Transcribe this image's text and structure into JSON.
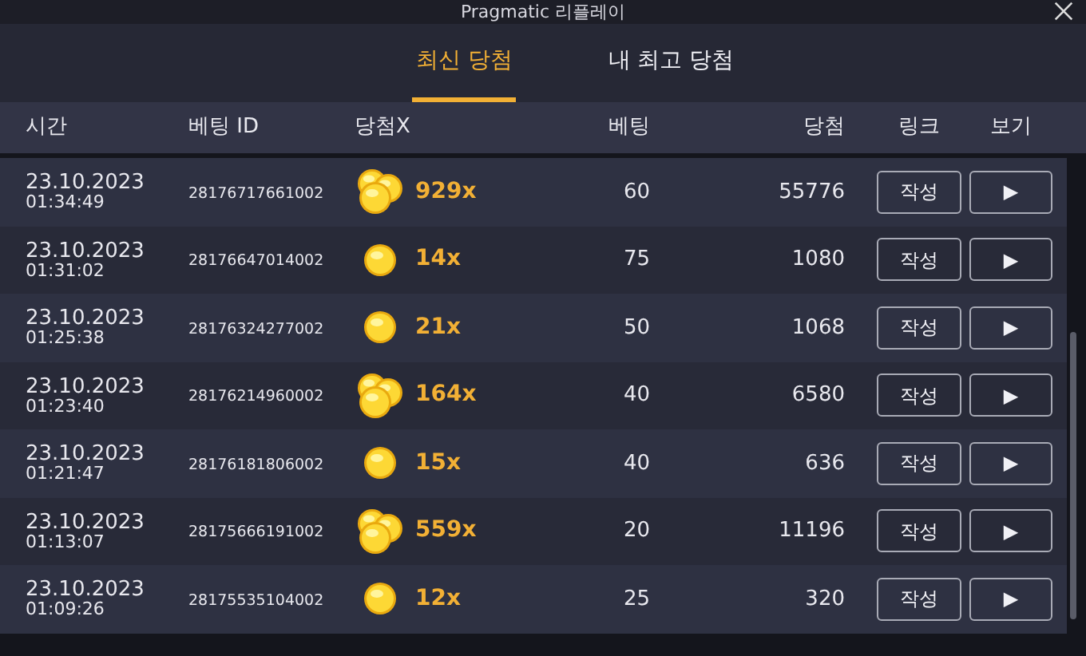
{
  "window": {
    "title": "Pragmatic 리플레이"
  },
  "tabs": [
    {
      "label": "최신 당첨",
      "selected": true
    },
    {
      "label": "내 최고 당첨",
      "selected": false
    }
  ],
  "table": {
    "columns": [
      "시간",
      "베팅 ID",
      "당첨X",
      "베팅",
      "당첨",
      "링크",
      "보기"
    ],
    "rows": [
      {
        "date": "23.10.2023",
        "time": "01:34:49",
        "bet_id": "28176717661002",
        "kind": "pile",
        "multiplier": "929x",
        "bet": "60",
        "win": "55776",
        "link": "작성",
        "play": "▶"
      },
      {
        "date": "23.10.2023",
        "time": "01:31:02",
        "bet_id": "28176647014002",
        "kind": "single",
        "multiplier": "14x",
        "bet": "75",
        "win": "1080",
        "link": "작성",
        "play": "▶"
      },
      {
        "date": "23.10.2023",
        "time": "01:25:38",
        "bet_id": "28176324277002",
        "kind": "single",
        "multiplier": "21x",
        "bet": "50",
        "win": "1068",
        "link": "작성",
        "play": "▶"
      },
      {
        "date": "23.10.2023",
        "time": "01:23:40",
        "bet_id": "28176214960002",
        "kind": "pile",
        "multiplier": "164x",
        "bet": "40",
        "win": "6580",
        "link": "작성",
        "play": "▶"
      },
      {
        "date": "23.10.2023",
        "time": "01:21:47",
        "bet_id": "28176181806002",
        "kind": "single",
        "multiplier": "15x",
        "bet": "40",
        "win": "636",
        "link": "작성",
        "play": "▶"
      },
      {
        "date": "23.10.2023",
        "time": "01:13:07",
        "bet_id": "28175666191002",
        "kind": "pile",
        "multiplier": "559x",
        "bet": "20",
        "win": "11196",
        "link": "작성",
        "play": "▶"
      },
      {
        "date": "23.10.2023",
        "time": "01:09:26",
        "bet_id": "28175535104002",
        "kind": "single",
        "multiplier": "12x",
        "bet": "25",
        "win": "320",
        "link": "작성",
        "play": "▶"
      }
    ]
  }
}
